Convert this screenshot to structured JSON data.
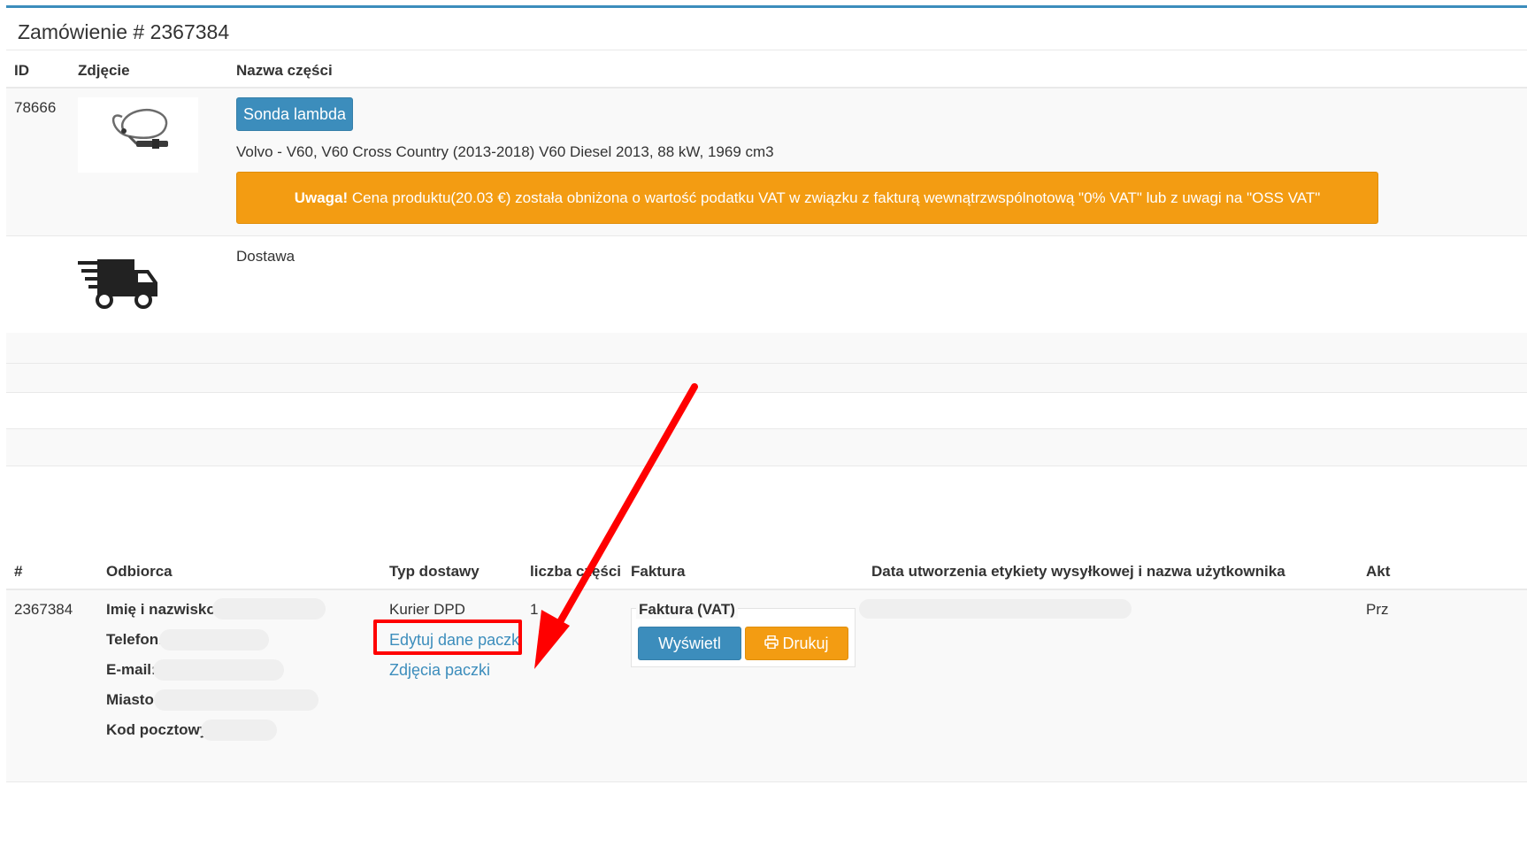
{
  "order": {
    "title": "Zamówienie # 2367384"
  },
  "parts_table": {
    "headers": {
      "id": "ID",
      "photo": "Zdjęcie",
      "name": "Nazwa części"
    },
    "row": {
      "id": "78666",
      "part_button": "Sonda lambda",
      "vehicle": "Volvo - V60, V60 Cross Country (2013-2018) V60 Diesel 2013, 88 kW, 1969 cm3",
      "alert_strong": "Uwaga!",
      "alert_text": " Cena produktu(20.03 €) została obniżona o wartość podatku VAT w związku z fakturą wewnątrzwspólnotową \"0% VAT\" lub z uwagi na \"OSS VAT\""
    },
    "delivery_row": {
      "label": "Dostawa"
    }
  },
  "shipment_table": {
    "headers": {
      "hash": "#",
      "recipient": "Odbiorca",
      "delivery_type": "Typ dostawy",
      "parts_count": "liczba części",
      "invoice": "Faktura",
      "label_date": "Data utworzenia etykiety wysyłkowej i nazwa użytkownika",
      "actions": "Akt"
    },
    "row": {
      "number": "2367384",
      "recipient_fields": {
        "name_label": "Imię i nazwisko:",
        "phone_label": "Telefon:",
        "email_label": "E-mail:",
        "city_label": "Miasto:",
        "postal_label": "Kod pocztowy:"
      },
      "delivery_type": "Kurier DPD",
      "edit_link": "Edytuj dane paczki",
      "photos_link": "Zdjęcia paczki",
      "parts_count": "1",
      "invoice_legend": "Faktura (VAT)",
      "view_button": "Wyświetl",
      "print_button": "Drukuj",
      "actions_partial": "Prz"
    }
  },
  "colors": {
    "primary": "#3c8dbc",
    "warning": "#f39c12",
    "annotation": "#ff0000"
  },
  "icons": {
    "truck": "delivery-truck-icon",
    "print": "print-icon"
  }
}
